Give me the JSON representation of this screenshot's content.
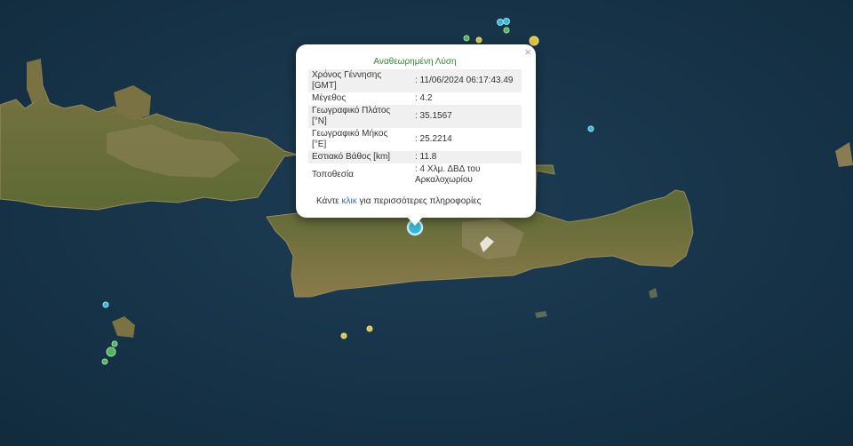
{
  "popup": {
    "title": "Αναθεωρημένη Λύση",
    "close_symbol": "×",
    "rows": [
      {
        "label": "Χρόνος Γέννησης [GMT]",
        "value": ": 11/06/2024 06:17:43.49"
      },
      {
        "label": "Μέγεθος",
        "value": ": 4.2"
      },
      {
        "label": "Γεωγραφικό Πλάτος [°N]",
        "value": ": 35.1567"
      },
      {
        "label": "Γεωγραφικό Μήκος [°E]",
        "value": ": 25.2214"
      },
      {
        "label": "Εστιακό Βάθος [km]",
        "value": ": 11.8"
      },
      {
        "label": "Τοποθεσία",
        "value": ": 4 Χλμ. ΔΒΔ του Αρκαλοχωρίου"
      }
    ],
    "more_prefix": "Κάντε",
    "more_link": "κλικ",
    "more_suffix": "για περισσότερες πληροφορίες"
  },
  "colors": {
    "sea": "#163246",
    "land": "#6f6a3d",
    "marker_cyan": "#39b6d6",
    "marker_green": "#52b35a",
    "marker_yellow": "#e3c23a",
    "title_green": "#2e8b2e",
    "link_blue": "#2a6fbf"
  },
  "markers": [
    {
      "type": "selected-event",
      "color": "cyan"
    },
    {
      "type": "event",
      "color": "cyan"
    },
    {
      "type": "event",
      "color": "green"
    },
    {
      "type": "event",
      "color": "yellow"
    }
  ]
}
